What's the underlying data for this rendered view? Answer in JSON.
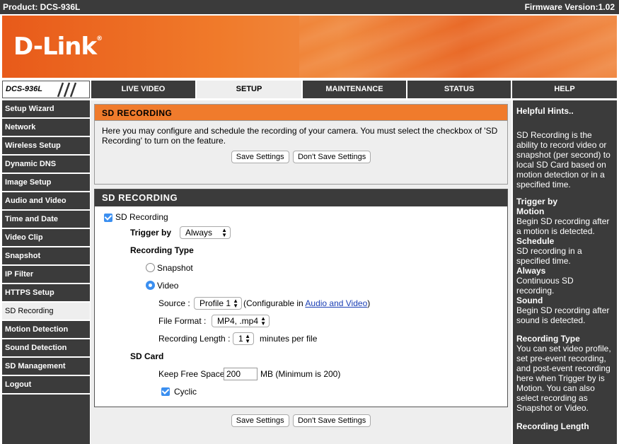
{
  "header": {
    "product": "Product: DCS-936L",
    "firmware": "Firmware Version:1.02"
  },
  "brand": {
    "logo": "D-Link",
    "trademark": "®"
  },
  "model_badge": "DCS-936L",
  "tabs": [
    "LIVE VIDEO",
    "SETUP",
    "MAINTENANCE",
    "STATUS",
    "HELP"
  ],
  "active_tab": "SETUP",
  "sidebar": {
    "items": [
      "Setup Wizard",
      "Network",
      "Wireless Setup",
      "Dynamic DNS",
      "Image Setup",
      "Audio and Video",
      "Time and Date",
      "Video Clip",
      "Snapshot",
      "IP Filter",
      "HTTPS Setup",
      "SD Recording",
      "Motion Detection",
      "Sound Detection",
      "SD Management",
      "Logout"
    ],
    "active": "SD Recording"
  },
  "intro": {
    "title": "SD RECORDING",
    "description": "Here you may configure and schedule the recording of your camera. You must select the checkbox of 'SD Recording' to turn on the feature.",
    "save_label": "Save Settings",
    "dont_save_label": "Don't Save Settings"
  },
  "form": {
    "title": "SD RECORDING",
    "sd_recording_label": "SD Recording",
    "sd_recording_checked": true,
    "trigger_label": "Trigger by",
    "trigger_value": "Always",
    "recording_type_label": "Recording Type",
    "snapshot_label": "Snapshot",
    "video_label": "Video",
    "selected_type": "Video",
    "source_label": "Source :",
    "source_value": "Profile 1",
    "configurable_prefix": "(Configurable in ",
    "configurable_link": "Audio and Video",
    "configurable_suffix": ")",
    "file_format_label": "File Format :",
    "file_format_value": "MP4, .mp4",
    "recording_length_label": "Recording Length :",
    "recording_length_value": "1",
    "recording_length_unit": "minutes per file",
    "sd_card_label": "SD Card",
    "keep_free_label": "Keep Free Space:",
    "keep_free_value": "200",
    "keep_free_unit": "MB (Minimum is 200)",
    "cyclic_label": "Cyclic",
    "cyclic_checked": true
  },
  "bottom_buttons": {
    "save_label": "Save Settings",
    "dont_save_label": "Don't Save Settings"
  },
  "help": {
    "title": "Helpful Hints..",
    "intro": "SD Recording is the ability to record video or snapshot (per second) to local SD Card based on motion detection or in a specified time.",
    "trigger_title": "Trigger by",
    "motion_title": "Motion",
    "motion_text": "Begin SD recording after a motion is detected.",
    "schedule_title": "Schedule",
    "schedule_text": "SD recording in a specified time.",
    "always_title": "Always",
    "always_text": "Continuous SD recording.",
    "sound_title": "Sound",
    "sound_text": "Begin SD recording after sound is detected.",
    "rectype_title": "Recording Type",
    "rectype_text": "You can set video profile, set pre-event recording, and post-event recording here when Trigger by is Motion. You can also select recording as Snapshot or Video.",
    "reclength_title": "Recording Length"
  },
  "colors": {
    "orange_header": "#f07b2c",
    "dark": "#3b3b3b",
    "panel_bg": "#eeeeee",
    "accent_blue": "#3b8ff0"
  }
}
